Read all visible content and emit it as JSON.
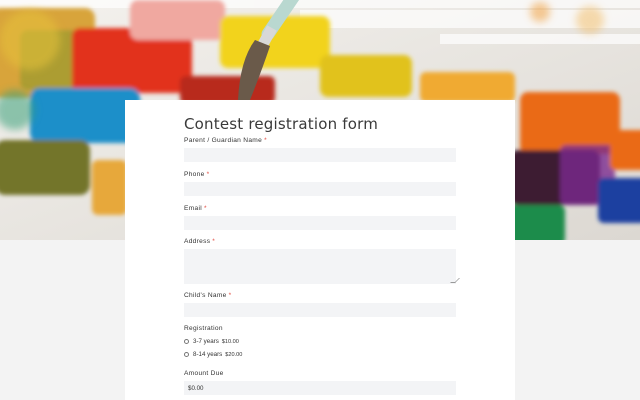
{
  "form": {
    "title": "Contest registration form",
    "required_mark": "*",
    "fields": {
      "parent_name": {
        "label": "Parent / Guardian Name",
        "value": "",
        "required": true
      },
      "phone": {
        "label": "Phone",
        "value": "",
        "required": true
      },
      "email": {
        "label": "Email",
        "value": "",
        "required": true
      },
      "address": {
        "label": "Address",
        "value": "",
        "required": true
      },
      "child_name": {
        "label": "Child's Name",
        "required": true,
        "value": ""
      },
      "registration": {
        "label": "Registration",
        "options": [
          {
            "label": "3-7 years",
            "price": "$10.00",
            "selected": false
          },
          {
            "label": "8-14 years",
            "price": "$20.00",
            "selected": false
          }
        ]
      },
      "amount_due": {
        "label": "Amount Due",
        "value": "$0.00"
      }
    }
  },
  "colors": {
    "page_background": "#f3f3f3",
    "card_background": "#ffffff",
    "field_background": "#f3f4f6",
    "required_red": "#e0463b"
  }
}
